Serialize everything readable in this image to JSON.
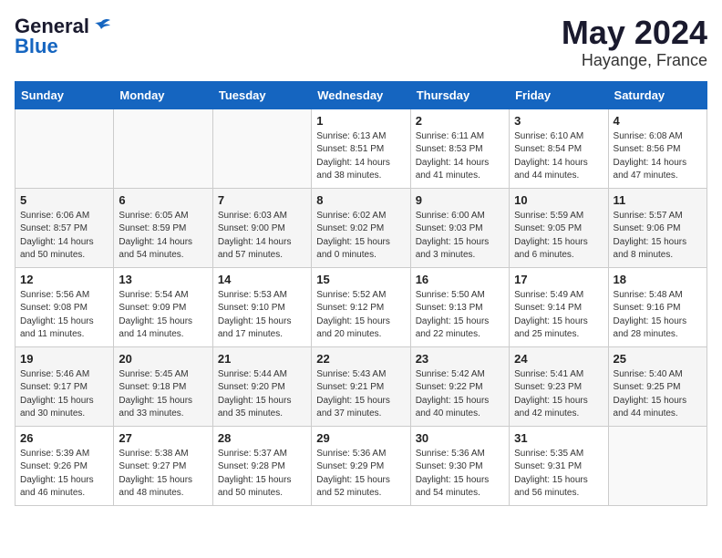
{
  "header": {
    "logo_line1": "General",
    "logo_line2": "Blue",
    "title": "May 2024",
    "subtitle": "Hayange, France"
  },
  "days_of_week": [
    "Sunday",
    "Monday",
    "Tuesday",
    "Wednesday",
    "Thursday",
    "Friday",
    "Saturday"
  ],
  "weeks": [
    [
      {
        "num": "",
        "lines": []
      },
      {
        "num": "",
        "lines": []
      },
      {
        "num": "",
        "lines": []
      },
      {
        "num": "1",
        "lines": [
          "Sunrise: 6:13 AM",
          "Sunset: 8:51 PM",
          "Daylight: 14 hours",
          "and 38 minutes."
        ]
      },
      {
        "num": "2",
        "lines": [
          "Sunrise: 6:11 AM",
          "Sunset: 8:53 PM",
          "Daylight: 14 hours",
          "and 41 minutes."
        ]
      },
      {
        "num": "3",
        "lines": [
          "Sunrise: 6:10 AM",
          "Sunset: 8:54 PM",
          "Daylight: 14 hours",
          "and 44 minutes."
        ]
      },
      {
        "num": "4",
        "lines": [
          "Sunrise: 6:08 AM",
          "Sunset: 8:56 PM",
          "Daylight: 14 hours",
          "and 47 minutes."
        ]
      }
    ],
    [
      {
        "num": "5",
        "lines": [
          "Sunrise: 6:06 AM",
          "Sunset: 8:57 PM",
          "Daylight: 14 hours",
          "and 50 minutes."
        ]
      },
      {
        "num": "6",
        "lines": [
          "Sunrise: 6:05 AM",
          "Sunset: 8:59 PM",
          "Daylight: 14 hours",
          "and 54 minutes."
        ]
      },
      {
        "num": "7",
        "lines": [
          "Sunrise: 6:03 AM",
          "Sunset: 9:00 PM",
          "Daylight: 14 hours",
          "and 57 minutes."
        ]
      },
      {
        "num": "8",
        "lines": [
          "Sunrise: 6:02 AM",
          "Sunset: 9:02 PM",
          "Daylight: 15 hours",
          "and 0 minutes."
        ]
      },
      {
        "num": "9",
        "lines": [
          "Sunrise: 6:00 AM",
          "Sunset: 9:03 PM",
          "Daylight: 15 hours",
          "and 3 minutes."
        ]
      },
      {
        "num": "10",
        "lines": [
          "Sunrise: 5:59 AM",
          "Sunset: 9:05 PM",
          "Daylight: 15 hours",
          "and 6 minutes."
        ]
      },
      {
        "num": "11",
        "lines": [
          "Sunrise: 5:57 AM",
          "Sunset: 9:06 PM",
          "Daylight: 15 hours",
          "and 8 minutes."
        ]
      }
    ],
    [
      {
        "num": "12",
        "lines": [
          "Sunrise: 5:56 AM",
          "Sunset: 9:08 PM",
          "Daylight: 15 hours",
          "and 11 minutes."
        ]
      },
      {
        "num": "13",
        "lines": [
          "Sunrise: 5:54 AM",
          "Sunset: 9:09 PM",
          "Daylight: 15 hours",
          "and 14 minutes."
        ]
      },
      {
        "num": "14",
        "lines": [
          "Sunrise: 5:53 AM",
          "Sunset: 9:10 PM",
          "Daylight: 15 hours",
          "and 17 minutes."
        ]
      },
      {
        "num": "15",
        "lines": [
          "Sunrise: 5:52 AM",
          "Sunset: 9:12 PM",
          "Daylight: 15 hours",
          "and 20 minutes."
        ]
      },
      {
        "num": "16",
        "lines": [
          "Sunrise: 5:50 AM",
          "Sunset: 9:13 PM",
          "Daylight: 15 hours",
          "and 22 minutes."
        ]
      },
      {
        "num": "17",
        "lines": [
          "Sunrise: 5:49 AM",
          "Sunset: 9:14 PM",
          "Daylight: 15 hours",
          "and 25 minutes."
        ]
      },
      {
        "num": "18",
        "lines": [
          "Sunrise: 5:48 AM",
          "Sunset: 9:16 PM",
          "Daylight: 15 hours",
          "and 28 minutes."
        ]
      }
    ],
    [
      {
        "num": "19",
        "lines": [
          "Sunrise: 5:46 AM",
          "Sunset: 9:17 PM",
          "Daylight: 15 hours",
          "and 30 minutes."
        ]
      },
      {
        "num": "20",
        "lines": [
          "Sunrise: 5:45 AM",
          "Sunset: 9:18 PM",
          "Daylight: 15 hours",
          "and 33 minutes."
        ]
      },
      {
        "num": "21",
        "lines": [
          "Sunrise: 5:44 AM",
          "Sunset: 9:20 PM",
          "Daylight: 15 hours",
          "and 35 minutes."
        ]
      },
      {
        "num": "22",
        "lines": [
          "Sunrise: 5:43 AM",
          "Sunset: 9:21 PM",
          "Daylight: 15 hours",
          "and 37 minutes."
        ]
      },
      {
        "num": "23",
        "lines": [
          "Sunrise: 5:42 AM",
          "Sunset: 9:22 PM",
          "Daylight: 15 hours",
          "and 40 minutes."
        ]
      },
      {
        "num": "24",
        "lines": [
          "Sunrise: 5:41 AM",
          "Sunset: 9:23 PM",
          "Daylight: 15 hours",
          "and 42 minutes."
        ]
      },
      {
        "num": "25",
        "lines": [
          "Sunrise: 5:40 AM",
          "Sunset: 9:25 PM",
          "Daylight: 15 hours",
          "and 44 minutes."
        ]
      }
    ],
    [
      {
        "num": "26",
        "lines": [
          "Sunrise: 5:39 AM",
          "Sunset: 9:26 PM",
          "Daylight: 15 hours",
          "and 46 minutes."
        ]
      },
      {
        "num": "27",
        "lines": [
          "Sunrise: 5:38 AM",
          "Sunset: 9:27 PM",
          "Daylight: 15 hours",
          "and 48 minutes."
        ]
      },
      {
        "num": "28",
        "lines": [
          "Sunrise: 5:37 AM",
          "Sunset: 9:28 PM",
          "Daylight: 15 hours",
          "and 50 minutes."
        ]
      },
      {
        "num": "29",
        "lines": [
          "Sunrise: 5:36 AM",
          "Sunset: 9:29 PM",
          "Daylight: 15 hours",
          "and 52 minutes."
        ]
      },
      {
        "num": "30",
        "lines": [
          "Sunrise: 5:36 AM",
          "Sunset: 9:30 PM",
          "Daylight: 15 hours",
          "and 54 minutes."
        ]
      },
      {
        "num": "31",
        "lines": [
          "Sunrise: 5:35 AM",
          "Sunset: 9:31 PM",
          "Daylight: 15 hours",
          "and 56 minutes."
        ]
      },
      {
        "num": "",
        "lines": []
      }
    ]
  ]
}
